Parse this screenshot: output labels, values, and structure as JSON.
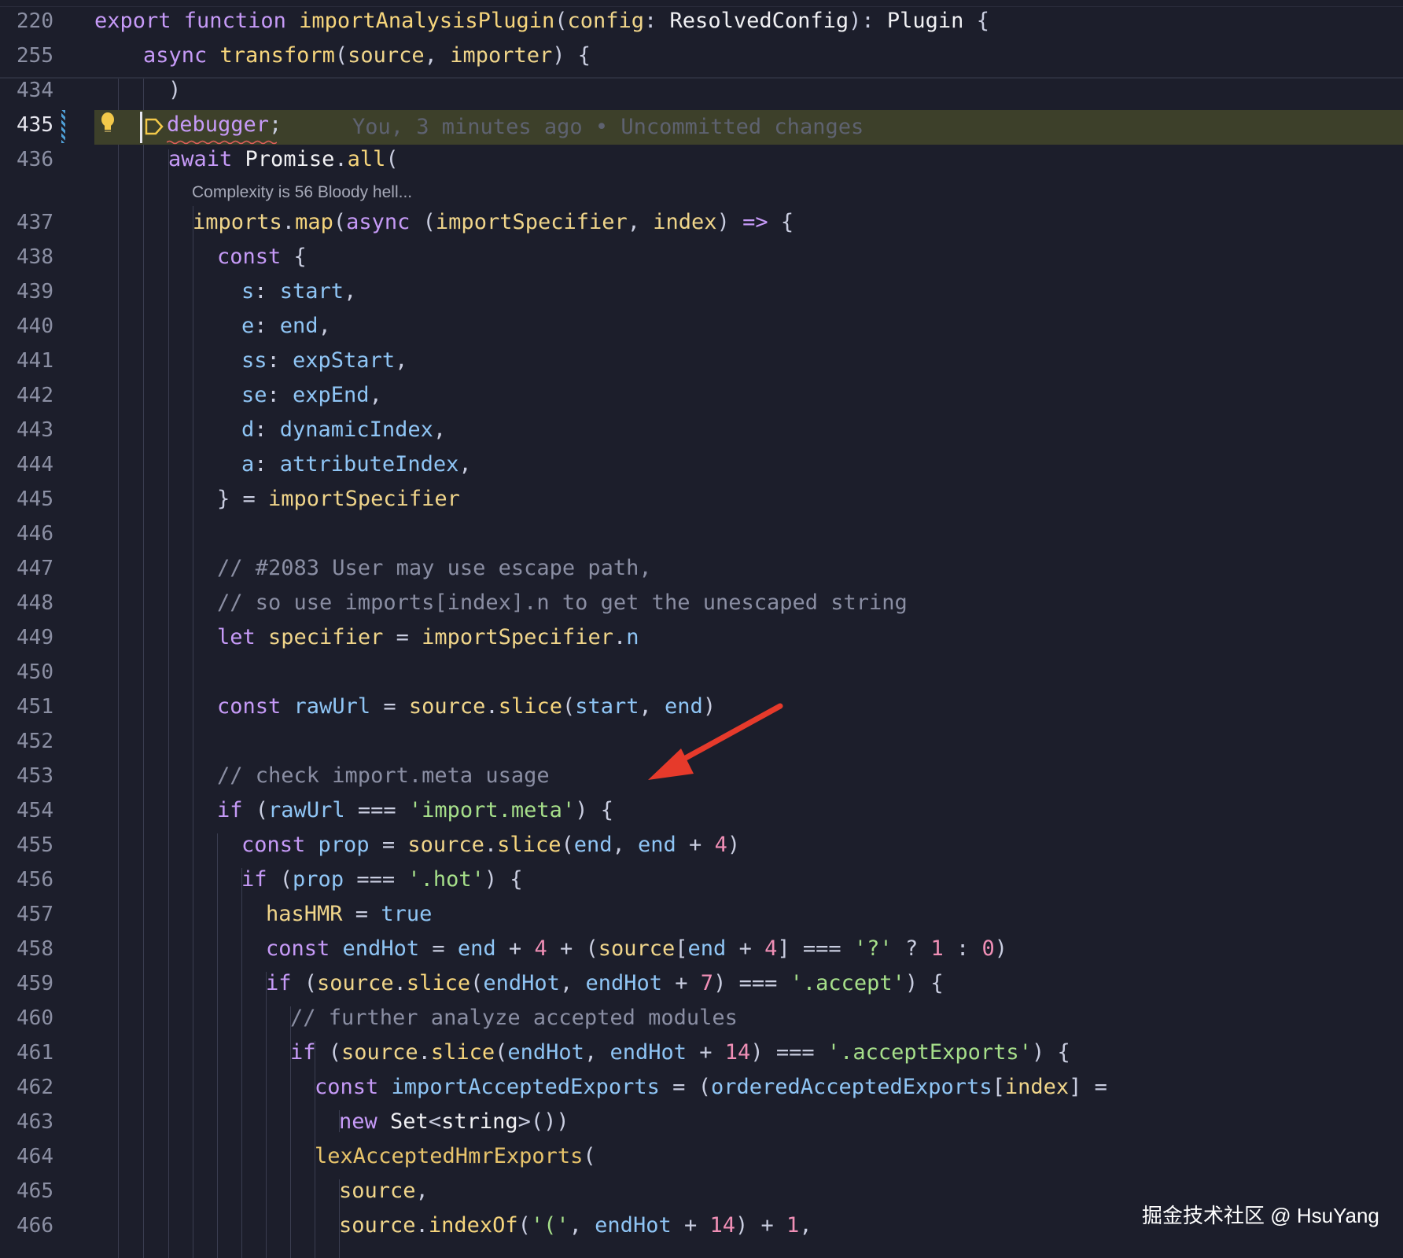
{
  "editor": {
    "line_numbers": [
      "220",
      "255",
      "434",
      "435",
      "436",
      "437",
      "438",
      "439",
      "440",
      "441",
      "442",
      "443",
      "444",
      "445",
      "446",
      "447",
      "448",
      "449",
      "450",
      "451",
      "452",
      "453",
      "454",
      "455",
      "456",
      "457",
      "458",
      "459",
      "460",
      "461",
      "462",
      "463",
      "464",
      "465",
      "466"
    ],
    "active_line": "435",
    "blame_annotation": "You, 3 minutes ago • Uncommitted changes",
    "codelens": "Complexity is 56 Bloody hell...",
    "colors": {
      "background": "#1c1e2b",
      "current_line_highlight": "#3d402a",
      "arrow": "#e63a2b"
    },
    "icons": [
      "lightbulb-icon",
      "breakpoint-icon",
      "red-arrow-annotation"
    ]
  },
  "code": [
    [
      [
        "k",
        "export "
      ],
      [
        "k",
        "function "
      ],
      [
        "f",
        "importAnalysisPlugin"
      ],
      [
        "p",
        "("
      ],
      [
        "v",
        "config"
      ],
      [
        "p",
        ": "
      ],
      [
        "t",
        "ResolvedConfig"
      ],
      [
        "p",
        "): "
      ],
      [
        "t",
        "Plugin "
      ],
      [
        "p",
        "{"
      ]
    ],
    [
      [
        "k",
        "async "
      ],
      [
        "f",
        "transform"
      ],
      [
        "p",
        "("
      ],
      [
        "v",
        "source"
      ],
      [
        "p",
        ", "
      ],
      [
        "v",
        "importer"
      ],
      [
        "p",
        ") {"
      ]
    ],
    [
      [
        "p",
        ")"
      ]
    ],
    [
      [
        "dbg",
        "debugger"
      ],
      [
        "p",
        ";"
      ]
    ],
    [
      [
        "k",
        "await "
      ],
      [
        "t",
        "Promise"
      ],
      [
        "p",
        "."
      ],
      [
        "f",
        "all"
      ],
      [
        "p",
        "("
      ]
    ],
    [
      [
        "v",
        "imports"
      ],
      [
        "p",
        "."
      ],
      [
        "f",
        "map"
      ],
      [
        "p",
        "("
      ],
      [
        "k",
        "async "
      ],
      [
        "p",
        "("
      ],
      [
        "v",
        "importSpecifier"
      ],
      [
        "p",
        ", "
      ],
      [
        "v",
        "index"
      ],
      [
        "p",
        ") "
      ],
      [
        "k",
        "=> "
      ],
      [
        "p",
        "{"
      ]
    ],
    [
      [
        "k",
        "const "
      ],
      [
        "p",
        "{"
      ]
    ],
    [
      [
        "prop",
        "s"
      ],
      [
        "p",
        ": "
      ],
      [
        "b",
        "start"
      ],
      [
        "p",
        ","
      ]
    ],
    [
      [
        "prop",
        "e"
      ],
      [
        "p",
        ": "
      ],
      [
        "b",
        "end"
      ],
      [
        "p",
        ","
      ]
    ],
    [
      [
        "prop",
        "ss"
      ],
      [
        "p",
        ": "
      ],
      [
        "b",
        "expStart"
      ],
      [
        "p",
        ","
      ]
    ],
    [
      [
        "prop",
        "se"
      ],
      [
        "p",
        ": "
      ],
      [
        "b",
        "expEnd"
      ],
      [
        "p",
        ","
      ]
    ],
    [
      [
        "prop",
        "d"
      ],
      [
        "p",
        ": "
      ],
      [
        "b",
        "dynamicIndex"
      ],
      [
        "p",
        ","
      ]
    ],
    [
      [
        "prop",
        "a"
      ],
      [
        "p",
        ": "
      ],
      [
        "b",
        "attributeIndex"
      ],
      [
        "p",
        ","
      ]
    ],
    [
      [
        "p",
        "} = "
      ],
      [
        "v",
        "importSpecifier"
      ]
    ],
    [],
    [
      [
        "c",
        "// #2083 User may use escape path,"
      ]
    ],
    [
      [
        "c",
        "// so use imports[index].n to get the unescaped string"
      ]
    ],
    [
      [
        "k",
        "let "
      ],
      [
        "v",
        "specifier"
      ],
      [
        "p",
        " = "
      ],
      [
        "v",
        "importSpecifier"
      ],
      [
        "p",
        "."
      ],
      [
        "b",
        "n"
      ]
    ],
    [],
    [
      [
        "k",
        "const "
      ],
      [
        "b",
        "rawUrl"
      ],
      [
        "p",
        " = "
      ],
      [
        "v",
        "source"
      ],
      [
        "p",
        "."
      ],
      [
        "f",
        "slice"
      ],
      [
        "p",
        "("
      ],
      [
        "b",
        "start"
      ],
      [
        "p",
        ", "
      ],
      [
        "b",
        "end"
      ],
      [
        "p",
        ")"
      ]
    ],
    [],
    [
      [
        "c",
        "// check import.meta usage"
      ]
    ],
    [
      [
        "k",
        "if "
      ],
      [
        "p",
        "("
      ],
      [
        "b",
        "rawUrl"
      ],
      [
        "p",
        " === "
      ],
      [
        "s",
        "'import.meta'"
      ],
      [
        "p",
        ") {"
      ]
    ],
    [
      [
        "k",
        "const "
      ],
      [
        "b",
        "prop"
      ],
      [
        "p",
        " = "
      ],
      [
        "v",
        "source"
      ],
      [
        "p",
        "."
      ],
      [
        "f",
        "slice"
      ],
      [
        "p",
        "("
      ],
      [
        "b",
        "end"
      ],
      [
        "p",
        ", "
      ],
      [
        "b",
        "end"
      ],
      [
        "p",
        " + "
      ],
      [
        "n",
        "4"
      ],
      [
        "p",
        ")"
      ]
    ],
    [
      [
        "k",
        "if "
      ],
      [
        "p",
        "("
      ],
      [
        "b",
        "prop"
      ],
      [
        "p",
        " === "
      ],
      [
        "s",
        "'.hot'"
      ],
      [
        "p",
        ") {"
      ]
    ],
    [
      [
        "v",
        "hasHMR"
      ],
      [
        "p",
        " = "
      ],
      [
        "b",
        "true"
      ]
    ],
    [
      [
        "k",
        "const "
      ],
      [
        "b",
        "endHot"
      ],
      [
        "p",
        " = "
      ],
      [
        "b",
        "end"
      ],
      [
        "p",
        " + "
      ],
      [
        "n",
        "4"
      ],
      [
        "p",
        " + ("
      ],
      [
        "v",
        "source"
      ],
      [
        "p",
        "["
      ],
      [
        "b",
        "end"
      ],
      [
        "p",
        " + "
      ],
      [
        "n",
        "4"
      ],
      [
        "p",
        "] === "
      ],
      [
        "s",
        "'?'"
      ],
      [
        "p",
        " ? "
      ],
      [
        "n",
        "1"
      ],
      [
        "p",
        " : "
      ],
      [
        "n",
        "0"
      ],
      [
        "p",
        ")"
      ]
    ],
    [
      [
        "k",
        "if "
      ],
      [
        "p",
        "("
      ],
      [
        "v",
        "source"
      ],
      [
        "p",
        "."
      ],
      [
        "f",
        "slice"
      ],
      [
        "p",
        "("
      ],
      [
        "b",
        "endHot"
      ],
      [
        "p",
        ", "
      ],
      [
        "b",
        "endHot"
      ],
      [
        "p",
        " + "
      ],
      [
        "n",
        "7"
      ],
      [
        "p",
        ") === "
      ],
      [
        "s",
        "'.accept'"
      ],
      [
        "p",
        ") {"
      ]
    ],
    [
      [
        "c",
        "// further analyze accepted modules"
      ]
    ],
    [
      [
        "k",
        "if "
      ],
      [
        "p",
        "("
      ],
      [
        "v",
        "source"
      ],
      [
        "p",
        "."
      ],
      [
        "f",
        "slice"
      ],
      [
        "p",
        "("
      ],
      [
        "b",
        "endHot"
      ],
      [
        "p",
        ", "
      ],
      [
        "b",
        "endHot"
      ],
      [
        "p",
        " + "
      ],
      [
        "n",
        "14"
      ],
      [
        "p",
        ") === "
      ],
      [
        "s",
        "'.acceptExports'"
      ],
      [
        "p",
        ") {"
      ]
    ],
    [
      [
        "k",
        "const "
      ],
      [
        "b",
        "importAcceptedExports"
      ],
      [
        "p",
        " = ("
      ],
      [
        "b",
        "orderedAcceptedExports"
      ],
      [
        "p",
        "["
      ],
      [
        "v",
        "index"
      ],
      [
        "p",
        "] ="
      ]
    ],
    [
      [
        "k",
        "new "
      ],
      [
        "t",
        "Set"
      ],
      [
        "p",
        "<"
      ],
      [
        "t",
        "string"
      ],
      [
        "p",
        ">())"
      ]
    ],
    [
      [
        "fn",
        "lexAcceptedHmrExports"
      ],
      [
        "p",
        "("
      ]
    ],
    [
      [
        "v",
        "source"
      ],
      [
        "p",
        ","
      ]
    ],
    [
      [
        "v",
        "source"
      ],
      [
        "p",
        "."
      ],
      [
        "f",
        "indexOf"
      ],
      [
        "p",
        "("
      ],
      [
        "s",
        "'('"
      ],
      [
        "p",
        ", "
      ],
      [
        "b",
        "endHot"
      ],
      [
        "p",
        " + "
      ],
      [
        "n",
        "14"
      ],
      [
        "p",
        ") + "
      ],
      [
        "n",
        "1"
      ],
      [
        "p",
        ","
      ]
    ]
  ],
  "watermark": "掘金技术社区 @ HsuYang"
}
